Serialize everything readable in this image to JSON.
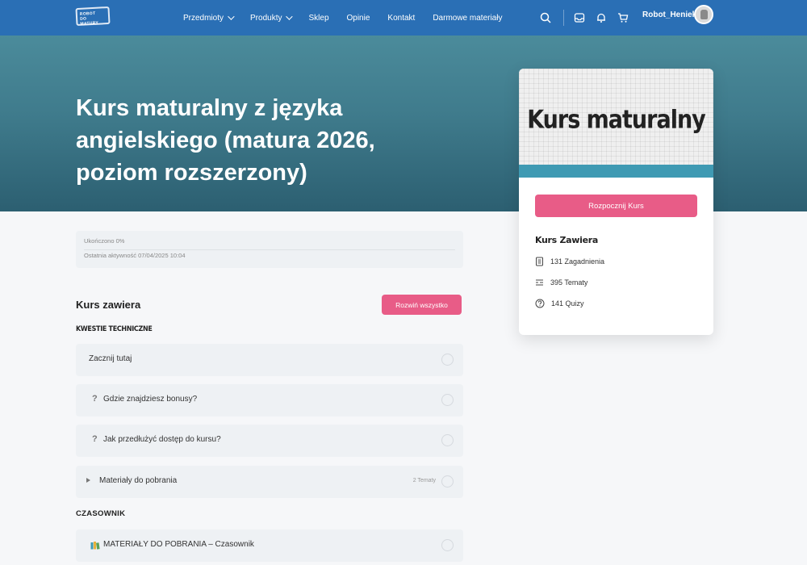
{
  "nav": {
    "logo_text": "ROBOT DO MATURY",
    "links": [
      {
        "label": "Przedmioty",
        "dropdown": true
      },
      {
        "label": "Produkty",
        "dropdown": true
      },
      {
        "label": "Sklep",
        "dropdown": false
      },
      {
        "label": "Opinie",
        "dropdown": false
      },
      {
        "label": "Kontakt",
        "dropdown": false
      },
      {
        "label": "Darmowe materiały",
        "dropdown": false
      }
    ],
    "icons": [
      "search-icon",
      "inbox-icon",
      "bell-icon",
      "cart-icon"
    ],
    "username": "Robot_Heniek",
    "bar_color": "#2a6fb5"
  },
  "hero": {
    "title": "Kurs maturalny z języka angielskiego (matura 2026, poziom rozszerzony)"
  },
  "card": {
    "image_title": "Kurs maturalny",
    "start_button": "Rozpocznij Kurs",
    "includes_title": "Kurs Zawiera",
    "stats": [
      {
        "icon": "document-icon",
        "label": "131 Zagadnienia"
      },
      {
        "icon": "list-icon",
        "label": "395 Tematy"
      },
      {
        "icon": "question-circle-icon",
        "label": "141 Quizy"
      }
    ],
    "accent_color": "#e85c87",
    "stripe_color": "#3f9ab3"
  },
  "progress": {
    "completed_label": "Ukończono 0%",
    "percent": 0,
    "last_activity": "Ostatnia aktywność 07/04/2025 10:04"
  },
  "content": {
    "heading": "Kurs zawiera",
    "expand_button": "Rozwiń wszystko",
    "groups": [
      {
        "title": "KWESTIE TECHNICZNE",
        "items": [
          {
            "label": "Zacznij tutaj",
            "icon": "",
            "count": ""
          },
          {
            "label": "Gdzie znajdziesz bonusy?",
            "icon": "question-icon",
            "count": ""
          },
          {
            "label": "Jak przedłużyć dostęp do kursu?",
            "icon": "question-icon",
            "count": ""
          },
          {
            "label": "Materiały do pobrania",
            "icon": "expand-arrow-icon",
            "count": "2 Tematy"
          }
        ]
      },
      {
        "title": "CZASOWNIK",
        "items": [
          {
            "label": "MATERIAŁY DO POBRANIA – Czasownik",
            "icon": "books-icon",
            "count": ""
          }
        ]
      }
    ]
  }
}
